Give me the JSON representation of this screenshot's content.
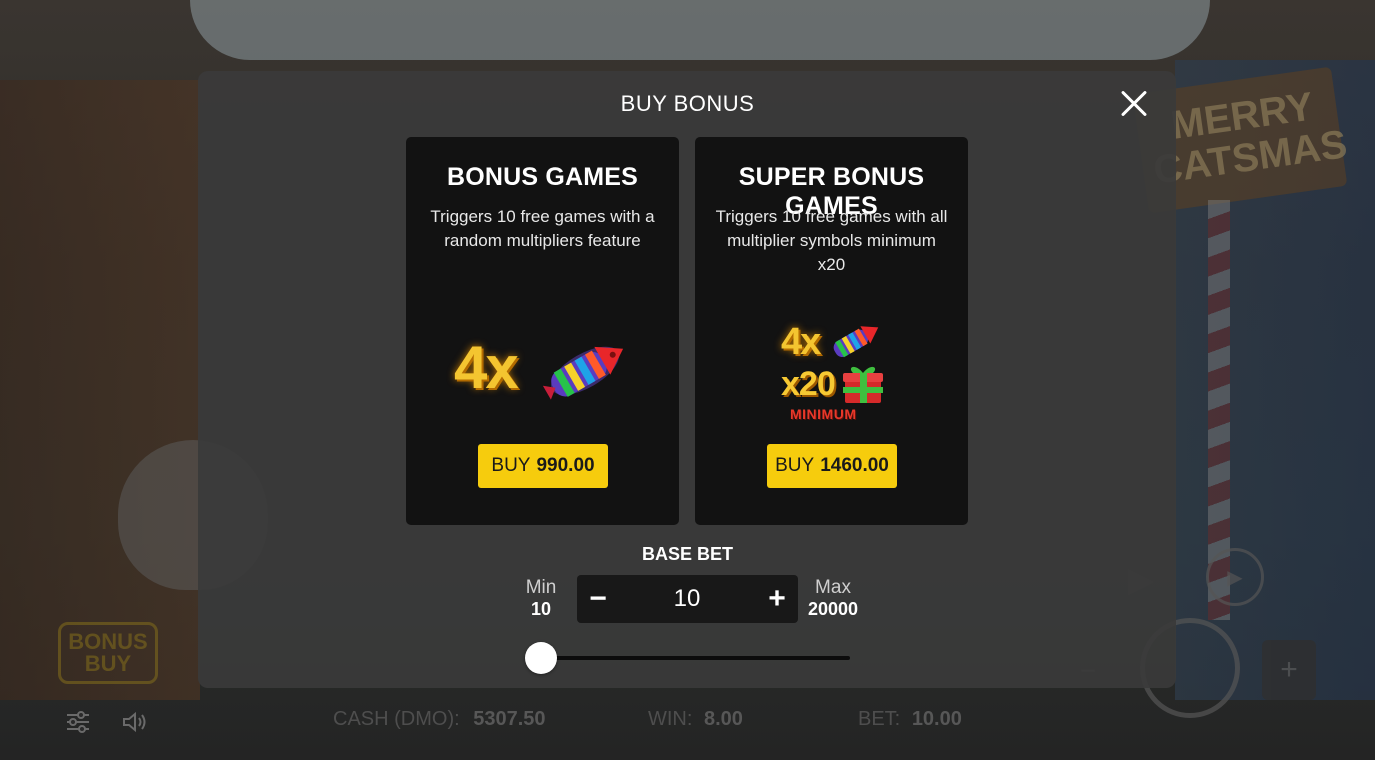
{
  "background": {
    "sign_text": "MERRY CATSMAS",
    "bonus_badge": {
      "line1": "BONUS",
      "line2": "BUY"
    }
  },
  "modal": {
    "title": "BUY BONUS",
    "cards": [
      {
        "title": "BONUS GAMES",
        "description": "Triggers 10 free games with a random multipliers feature",
        "illustration": {
          "multiplier": "4x"
        },
        "buy_label": "BUY",
        "buy_amount": "990.00"
      },
      {
        "title": "SUPER BONUS GAMES",
        "description": "Triggers 10 free games with all multiplier symbols minimum x20",
        "illustration": {
          "multiplier": "4x",
          "min_multiplier": "x20",
          "min_label": "MINIMUM"
        },
        "buy_label": "BUY",
        "buy_amount": "1460.00"
      }
    ],
    "base_bet": {
      "label": "BASE BET",
      "min_label": "Min",
      "min_value": "10",
      "max_label": "Max",
      "max_value": "20000",
      "value": "10",
      "decrement_symbol": "−",
      "increment_symbol": "+",
      "slider_position_fraction": 0.0
    }
  },
  "status_bar": {
    "cash_label": "CASH (DMO):",
    "cash_value": "5307.50",
    "win_label": "WIN:",
    "win_value": "8.00",
    "bet_label": "BET:",
    "bet_value": "10.00"
  },
  "colors": {
    "accent": "#f6cc0d",
    "card_bg": "#121212",
    "overlay_bg": "#3a3a3a"
  },
  "icons": [
    "settings-sliders-icon",
    "speaker-icon",
    "close-icon",
    "rocket-icon",
    "gift-icon",
    "play-icon"
  ]
}
